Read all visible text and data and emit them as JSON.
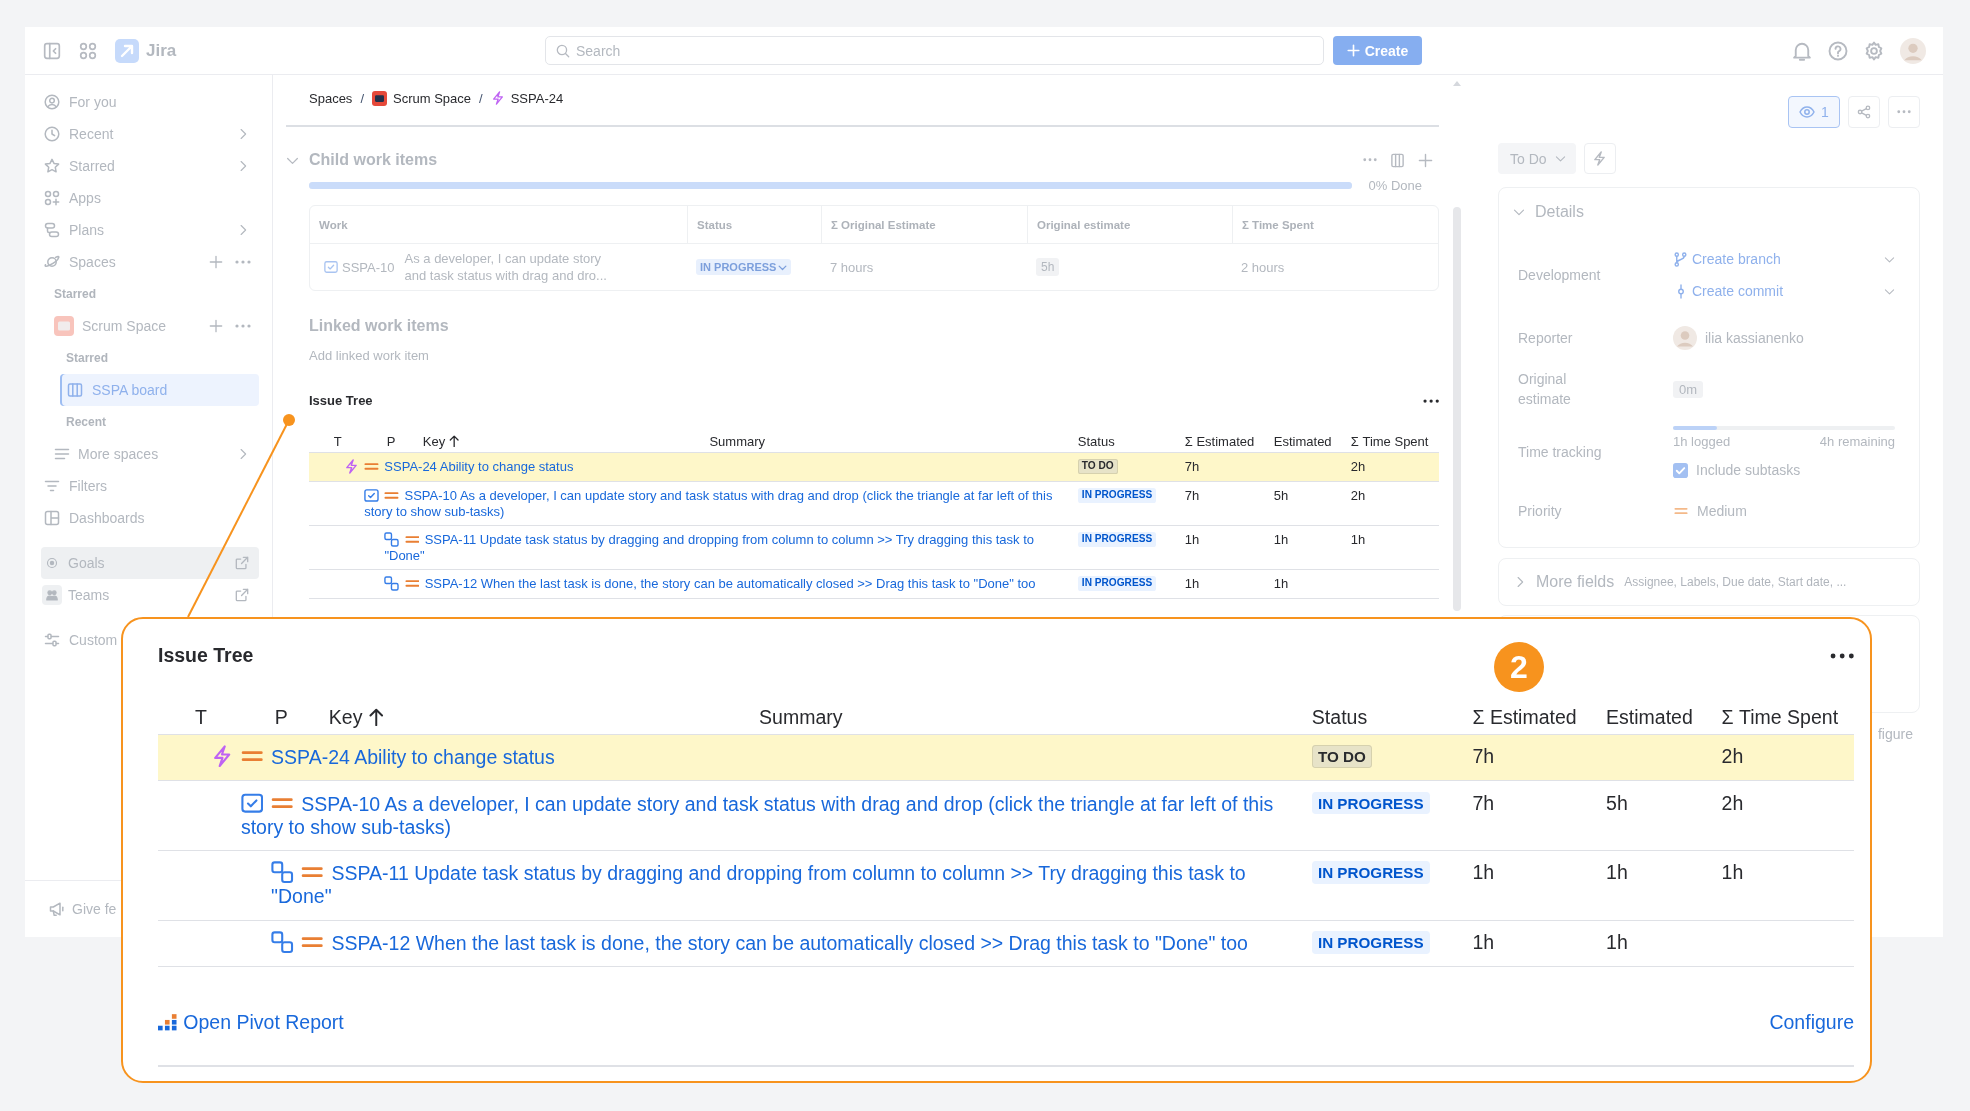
{
  "top_bar": {
    "app_name": "Jira",
    "search": {
      "placeholder": "Search"
    },
    "create_button": "Create"
  },
  "sidebar": {
    "items": [
      {
        "kind": "nav",
        "label": "For you",
        "selected": false,
        "hovered": false
      },
      {
        "kind": "menu",
        "label": "Recent",
        "selected": false,
        "hovered": false
      },
      {
        "kind": "menu",
        "label": "Starred",
        "selected": false,
        "hovered": false
      },
      {
        "kind": "nav",
        "label": "Apps",
        "selected": false,
        "hovered": false
      },
      {
        "kind": "menu",
        "label": "Plans",
        "selected": false,
        "hovered": false
      },
      {
        "kind": "section",
        "label": "Spaces",
        "selected": false,
        "hovered": false,
        "children": [
          {
            "kind": "heading",
            "label": "Starred"
          },
          {
            "kind": "space",
            "label": "Scrum Space",
            "selected": false,
            "children": [
              {
                "kind": "heading",
                "label": "Starred"
              },
              {
                "kind": "board",
                "label": "SSPA board",
                "selected": true
              },
              {
                "kind": "heading",
                "label": "Recent"
              }
            ]
          },
          {
            "kind": "menu",
            "label": "More spaces",
            "selected": false
          }
        ]
      },
      {
        "kind": "nav",
        "label": "Filters",
        "selected": false,
        "hovered": false
      },
      {
        "kind": "nav",
        "label": "Dashboards",
        "selected": false,
        "hovered": false
      },
      {
        "kind": "external",
        "label": "Goals",
        "selected": false,
        "hovered": true
      },
      {
        "kind": "external",
        "label": "Teams",
        "selected": false,
        "hovered": false
      },
      {
        "kind": "nav",
        "label": "Custom",
        "selected": false,
        "hovered": false
      }
    ],
    "feedback": "Give fe"
  },
  "work_item": {
    "breadcrumbs": {
      "items": [
        {
          "kind": "link",
          "label": "Spaces",
          "separator": "/"
        },
        {
          "kind": "space",
          "label": "Scrum Space",
          "separator": "/"
        },
        {
          "kind": "epic",
          "label": "SSPA-24"
        }
      ]
    },
    "child_work_items": {
      "title": "Child work items",
      "expanded": true,
      "progress": {
        "segments": [
          {
            "kind": "in_progress",
            "level": 1
          }
        ],
        "reading": "0% Done"
      },
      "columns": [
        "Work",
        "Status",
        "Σ Original Estimate",
        "Original estimate",
        "Σ Time Spent"
      ],
      "rows": [
        {
          "kind": "task",
          "key": "SSPA-10",
          "summary": "As a developer, I can update story and task status with drag and dro...",
          "status": {
            "label": "IN PROGRESS",
            "kind": "in_progress"
          },
          "original_estimate_sum": "7 hours",
          "original_estimate": "5h",
          "time_spent_sum": "2 hours"
        }
      ]
    },
    "linked_work_items": {
      "title": "Linked work items",
      "add_label": "Add linked work item"
    },
    "issue_tree": {
      "title": "Issue Tree",
      "columns": [
        {
          "label": "T",
          "sorted": false
        },
        {
          "label": "P",
          "sorted": false
        },
        {
          "label": "Key",
          "sorted": true
        },
        {
          "label": "Summary",
          "sorted": false
        },
        {
          "label": "Status",
          "sorted": false
        },
        {
          "label": "Σ Estimated",
          "sorted": false
        },
        {
          "label": "Estimated",
          "sorted": false
        },
        {
          "label": "Σ Time Spent",
          "sorted": false
        }
      ],
      "rows": [
        {
          "kind": "epic",
          "priority": {
            "kind": "medium"
          },
          "link": "SSPA-24 Ability to change status",
          "status": {
            "label": "TO DO",
            "kind": "todo"
          },
          "estimated_sum": "7h",
          "time_spent_sum": "2h",
          "selected": true,
          "children": [
            {
              "kind": "task",
              "priority": {
                "kind": "medium"
              },
              "link": "SSPA-10 As a developer, I can update story and task status with drag and drop (click the triangle at far left of this story to show sub-tasks)",
              "status": {
                "label": "IN PROGRESS",
                "kind": "in_progress"
              },
              "estimated_sum": "7h",
              "estimated": "5h",
              "time_spent_sum": "2h",
              "selected": false,
              "children": [
                {
                  "kind": "subtask",
                  "priority": {
                    "kind": "medium"
                  },
                  "link": "SSPA-11 Update task status by dragging and dropping from column to column >> Try dragging this task to \"Done\"",
                  "status": {
                    "label": "IN PROGRESS",
                    "kind": "in_progress"
                  },
                  "estimated_sum": "1h",
                  "estimated": "1h",
                  "time_spent_sum": "1h",
                  "selected": false
                },
                {
                  "kind": "subtask",
                  "priority": {
                    "kind": "medium"
                  },
                  "link": "SSPA-12 When the last task is done, the story can be automatically closed >> Drag this task to \"Done\" too",
                  "status": {
                    "label": "IN PROGRESS",
                    "kind": "in_progress"
                  },
                  "estimated_sum": "1h",
                  "estimated": "1h",
                  "selected": false
                }
              ]
            }
          ]
        }
      ]
    }
  },
  "details_panel": {
    "watch_button": {
      "count": "1",
      "watching": true
    },
    "status_button": "To Do",
    "details": {
      "title": "Details",
      "expanded": true,
      "fields": [
        {
          "kind": "development",
          "label": "Development",
          "actions": [
            {
              "kind": "branch",
              "label": "Create branch"
            },
            {
              "kind": "commit",
              "label": "Create commit"
            }
          ]
        },
        {
          "kind": "person",
          "label": "Reporter",
          "value": "ilia kassianenko"
        },
        {
          "kind": "estimate",
          "label": "Original estimate",
          "value": "0m"
        },
        {
          "kind": "time_tracking",
          "label": "Time tracking",
          "level": 0.2,
          "logged": "1h logged",
          "remaining": "4h remaining",
          "checkbox": {
            "label": "Include subtasks",
            "checked": true
          }
        },
        {
          "kind": "priority",
          "label": "Priority",
          "priority": {
            "kind": "medium"
          },
          "value": "Medium"
        }
      ]
    },
    "more_fields": {
      "title": "More fields",
      "summary": "Assignee, Labels, Due date, Start date, ...",
      "expanded": false
    },
    "footer_link": "figure"
  },
  "callout": {
    "badge": "2",
    "issue_tree": {
      "title": "Issue Tree",
      "columns": [
        {
          "label": "T",
          "sorted": false
        },
        {
          "label": "P",
          "sorted": false
        },
        {
          "label": "Key",
          "sorted": true
        },
        {
          "label": "Summary",
          "sorted": false
        },
        {
          "label": "Status",
          "sorted": false
        },
        {
          "label": "Σ Estimated",
          "sorted": false
        },
        {
          "label": "Estimated",
          "sorted": false
        },
        {
          "label": "Σ Time Spent",
          "sorted": false
        }
      ],
      "rows": [
        {
          "kind": "epic",
          "priority": {
            "kind": "medium"
          },
          "link": "SSPA-24 Ability to change status",
          "status": {
            "label": "TO DO",
            "kind": "todo"
          },
          "estimated_sum": "7h",
          "time_spent_sum": "2h",
          "selected": true,
          "children": [
            {
              "kind": "task",
              "priority": {
                "kind": "medium"
              },
              "link": "SSPA-10 As a developer, I can update story and task status with drag and drop (click the triangle at far left of this story to show sub-tasks)",
              "status": {
                "label": "IN PROGRESS",
                "kind": "in_progress"
              },
              "estimated_sum": "7h",
              "estimated": "5h",
              "time_spent_sum": "2h",
              "selected": false,
              "children": [
                {
                  "kind": "subtask",
                  "priority": {
                    "kind": "medium"
                  },
                  "link": "SSPA-11 Update task status by dragging and dropping from column to column >> Try dragging this task to \"Done\"",
                  "status": {
                    "label": "IN PROGRESS",
                    "kind": "in_progress"
                  },
                  "estimated_sum": "1h",
                  "estimated": "1h",
                  "time_spent_sum": "1h",
                  "selected": false
                },
                {
                  "kind": "subtask",
                  "priority": {
                    "kind": "medium"
                  },
                  "link": "SSPA-12 When the last task is done, the story can be automatically closed >> Drag this task to \"Done\" too",
                  "status": {
                    "label": "IN PROGRESS",
                    "kind": "in_progress"
                  },
                  "estimated_sum": "1h",
                  "estimated": "1h",
                  "selected": false
                }
              ]
            }
          ]
        }
      ],
      "footer": {
        "report_link": "Open Pivot Report",
        "configure_link": "Configure"
      }
    }
  }
}
